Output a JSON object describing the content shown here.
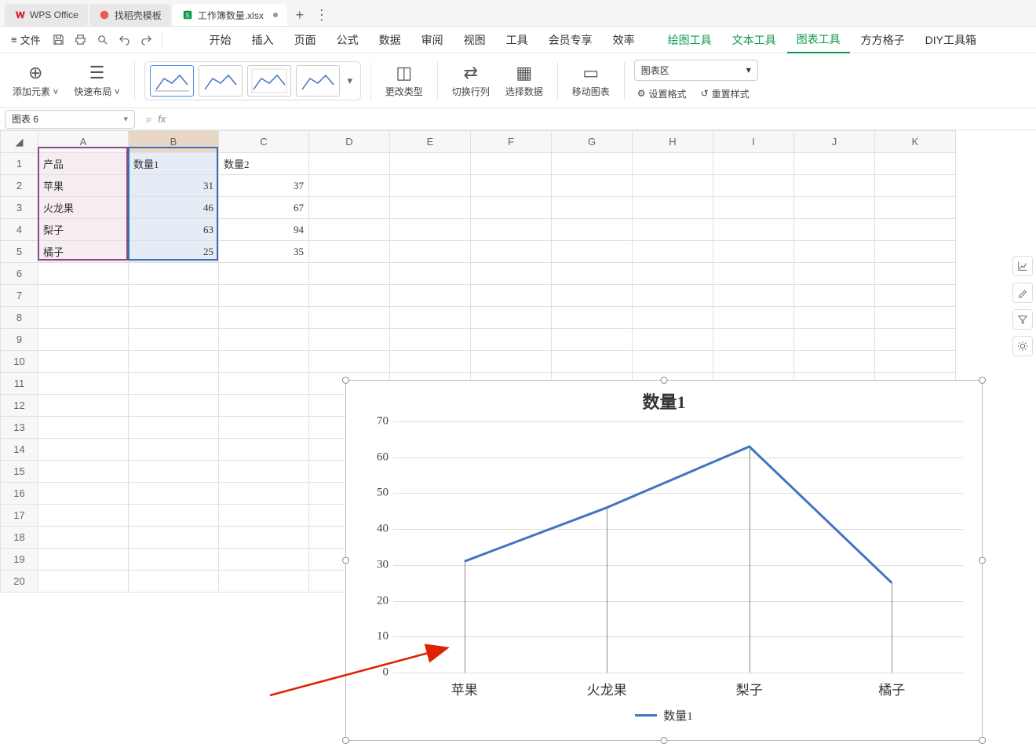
{
  "titlebar": {
    "tabs": [
      {
        "label": "WPS Office"
      },
      {
        "label": "找稻壳模板"
      },
      {
        "label": "工作簿数量.xlsx",
        "active": true
      }
    ],
    "add": "+",
    "more": "⋮"
  },
  "menubar": {
    "file_label": "文件",
    "items": [
      "开始",
      "插入",
      "页面",
      "公式",
      "数据",
      "审阅",
      "视图",
      "工具",
      "会员专享",
      "效率"
    ],
    "tool_items": [
      "绘图工具",
      "文本工具",
      "图表工具",
      "方方格子",
      "DIY工具箱"
    ],
    "active_tool": "图表工具"
  },
  "ribbon": {
    "add_element": "添加元素",
    "quick_layout": "快速布局",
    "change_type": "更改类型",
    "switch_rc": "切换行列",
    "select_data": "选择数据",
    "move_chart": "移动图表",
    "area_dropdown": "图表区",
    "set_format": "设置格式",
    "reset_style": "重置样式"
  },
  "namebox": {
    "value": "图表 6"
  },
  "sheet": {
    "columns": [
      "A",
      "B",
      "C",
      "D",
      "E",
      "F",
      "G",
      "H",
      "I",
      "J",
      "K"
    ],
    "rows_shown": 20,
    "data": {
      "headers": [
        "产品",
        "数量1",
        "数量2"
      ],
      "rows": [
        {
          "product": "苹果",
          "q1": 31,
          "q2": 37
        },
        {
          "product": "火龙果",
          "q1": 46,
          "q2": 67
        },
        {
          "product": "梨子",
          "q1": 63,
          "q2": 94
        },
        {
          "product": "橘子",
          "q1": 25,
          "q2": 35
        }
      ]
    }
  },
  "chart_data": {
    "type": "line",
    "title": "数量1",
    "categories": [
      "苹果",
      "火龙果",
      "梨子",
      "橘子"
    ],
    "series": [
      {
        "name": "数量1",
        "values": [
          31,
          46,
          63,
          25
        ]
      }
    ],
    "ylim": [
      0,
      70
    ],
    "ytick": 10,
    "xlabel": "",
    "ylabel": "",
    "legend_position": "bottom",
    "drop_lines": true
  }
}
